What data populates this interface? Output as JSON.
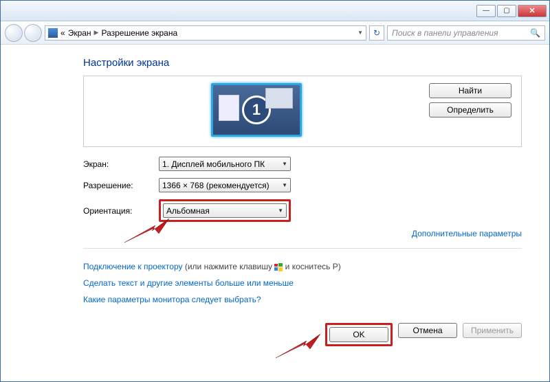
{
  "titlebar": {
    "min": "—",
    "max": "▢",
    "close": "✕"
  },
  "nav": {
    "crumb_prefix": "«",
    "crumb1": "Экран",
    "crumb2": "Разрешение экрана",
    "search_placeholder": "Поиск в панели управления"
  },
  "heading": "Настройки экрана",
  "buttons": {
    "find": "Найти",
    "detect": "Определить"
  },
  "monitor_number": "1",
  "labels": {
    "screen": "Экран:",
    "resolution": "Разрешение:",
    "orientation": "Ориентация:"
  },
  "selects": {
    "screen": "1. Дисплей мобильного ПК",
    "resolution": "1366 × 768 (рекомендуется)",
    "orientation": "Альбомная"
  },
  "adv_params": "Дополнительные параметры",
  "links": {
    "projector_a": "Подключение к проектору",
    "projector_b": " (или нажмите клавишу ",
    "projector_c": " и коснитесь P)",
    "textsize": "Сделать текст и другие элементы больше или меньше",
    "which": "Какие параметры монитора следует выбрать?"
  },
  "footer": {
    "ok": "OK",
    "cancel": "Отмена",
    "apply": "Применить"
  }
}
